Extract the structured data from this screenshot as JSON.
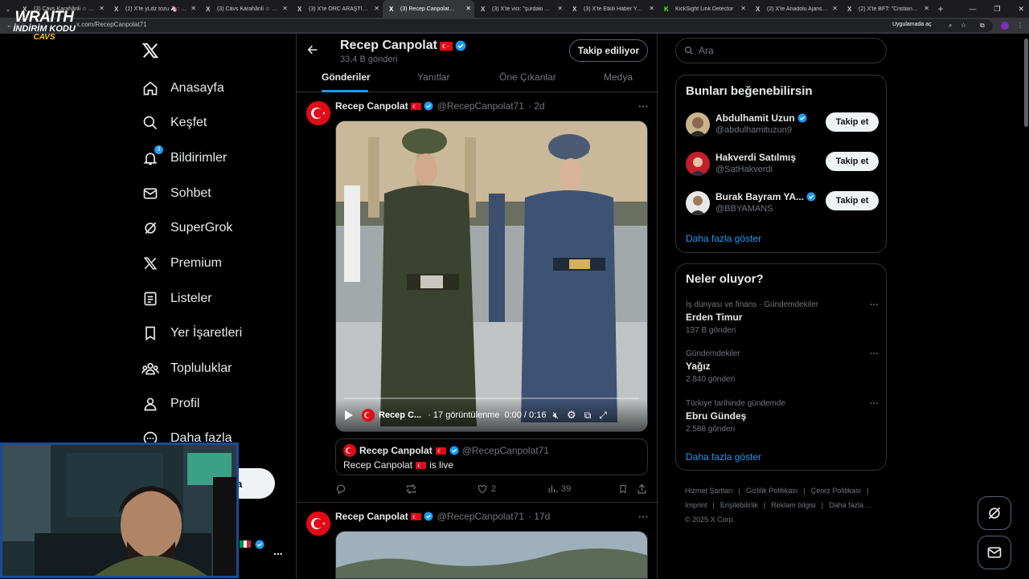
{
  "browser": {
    "tabs": [
      {
        "icon": "X",
        "title": "(3) Cävs Karahânli ☆ (@karah"
      },
      {
        "icon": "X",
        "title": "(1) X'te yLdz tozu 🦄: \"Asla e"
      },
      {
        "icon": "X",
        "title": "(3) Cävs Karahânli ☆ (@karah"
      },
      {
        "icon": "X",
        "title": "(3) X'te ORC ARAŞTIRMA: \"Ş"
      },
      {
        "icon": "X",
        "title": "(3) Recep Canpolat🇹🇷 (@Rece"
      },
      {
        "icon": "X",
        "title": "(3) X'te vici: \"şurdaki SSD (1tb"
      },
      {
        "icon": "X",
        "title": "(3) X'te Etkili Haber Yeni Saytı"
      },
      {
        "icon": "K",
        "title": "KickSight Link Detector"
      },
      {
        "icon": "X",
        "title": "(2) X'te Anadolu Ajansı: \"Kur"
      },
      {
        "icon": "X",
        "title": "(2) X'te BFT: \"Cristiano Ronal"
      }
    ],
    "active_tab_index": 4,
    "tabs_menu": "⌄",
    "close_glyph": "✕",
    "new_tab": "+",
    "window_controls": [
      "—",
      "❐",
      "✕"
    ],
    "url": "x.com/RecepCanpolat71",
    "install_chip": "Uygulamada aç"
  },
  "overlay_logo": {
    "line1": "WRAITH",
    "line2": "İNDİRİM KODU",
    "line3": "CAVS"
  },
  "sidebar": {
    "items": [
      {
        "label": "Anasayfa",
        "icon": "home-icon"
      },
      {
        "label": "Keşfet",
        "icon": "search-icon"
      },
      {
        "label": "Bildirimler",
        "icon": "bell-icon",
        "badge": "3"
      },
      {
        "label": "Sohbet",
        "icon": "mail-icon"
      },
      {
        "label": "SuperGrok",
        "icon": "grok-icon"
      },
      {
        "label": "Premium",
        "icon": "x-icon"
      },
      {
        "label": "Listeler",
        "icon": "list-icon"
      },
      {
        "label": "Yer İşaretleri",
        "icon": "bookmark-icon"
      },
      {
        "label": "Topluluklar",
        "icon": "communities-icon"
      },
      {
        "label": "Profil",
        "icon": "person-icon"
      },
      {
        "label": "Daha fazla",
        "icon": "more-circle-icon"
      }
    ],
    "post_button_partial": "a",
    "account_more": "..."
  },
  "profile": {
    "name": "Recep Canpolat",
    "post_count": "33,4 B gönderi",
    "follow_state": "Takip ediliyor",
    "tabs": [
      "Gönderiler",
      "Yanıtlar",
      "Öne Çıkanlar",
      "Medya"
    ],
    "active_tab": 0
  },
  "posts": [
    {
      "name": "Recep Canpolat",
      "handle": "@RecepCanpolat71",
      "time": "· 2d",
      "video": {
        "channel": "Recep C...",
        "views": "· 17 görüntülenme",
        "time": "0:00 / 0:16"
      },
      "quote": {
        "name": "Recep Canpolat",
        "handle": "@RecepCanpolat71",
        "text_before": "Recep Canpolat",
        "text_after": "is live"
      },
      "actions": {
        "replies": "",
        "reposts": "",
        "likes": "2",
        "views": "39"
      }
    },
    {
      "name": "Recep Canpolat",
      "handle": "@RecepCanpolat71",
      "time": "· 17d"
    }
  ],
  "right": {
    "search_placeholder": "Ara",
    "who_to_follow": {
      "title": "Bunları beğenebilirsin",
      "users": [
        {
          "name": "Abdulhamit Uzun",
          "handle": "@abdulhamituzun9",
          "verified": true
        },
        {
          "name": "Hakverdi Satılmış",
          "handle": "@SatHakverdi",
          "verified": false
        },
        {
          "name": "Burak Bayram YA...",
          "handle": "@BBYAMANS",
          "verified": true
        }
      ],
      "follow_label": "Takip et",
      "show_more": "Daha fazla göster"
    },
    "trends": {
      "title": "Neler oluyor?",
      "items": [
        {
          "context": "İş dünyası ve finans · Gündemdekiler",
          "name": "Erden Timur",
          "count": "137 B gönderi"
        },
        {
          "context": "Gündemdekiler",
          "name": "Yağız",
          "count": "2.840 gönderi"
        },
        {
          "context": "Türkiye tarihinde gündemde",
          "name": "Ebru Gündeş",
          "count": "2.588 gönderi"
        }
      ],
      "show_more": "Daha fazla göster"
    },
    "footer": [
      "Hizmet Şartları",
      "|",
      "Gizlilik Politikası",
      "|",
      "Çerez Politikası",
      "|",
      "Imprint",
      "|",
      "Erişilebilirlik",
      "|",
      "Reklam bilgisi",
      "|",
      "Daha fazla ...",
      "© 2025 X Corp."
    ]
  },
  "colors": {
    "accent": "#1d9bf0",
    "flag_red": "#e30a17",
    "background": "#000000",
    "border": "#2f3336"
  }
}
